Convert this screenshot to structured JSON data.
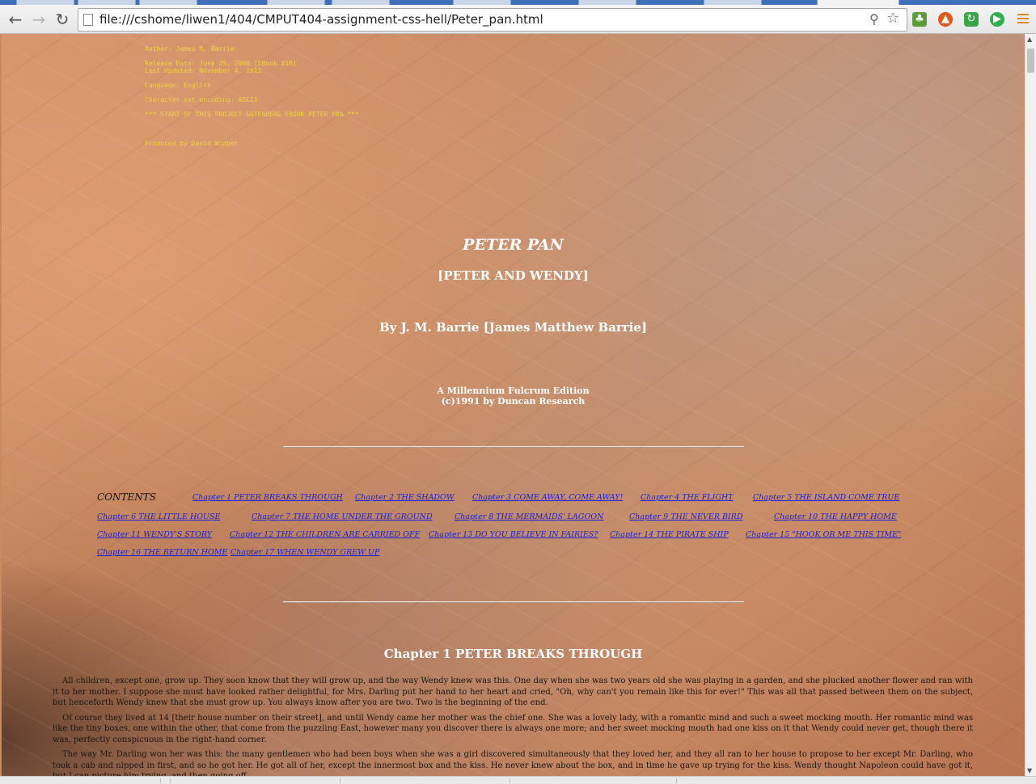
{
  "browser": {
    "url": "file:///cshome/liwen1/404/CMPUT404-assignment-css-hell/Peter_pan.html"
  },
  "gutenberg_header": [
    "Author: James M. Barrie",
    "Release Date: June 25, 2008 [EBook #16]\nLast Updated: November 4, 2012",
    "Language: English",
    "Character set encoding: ASCII",
    "*** START OF THIS PROJECT GUTENBERG EBOOK PETER PAN ***",
    "Produced by David Widger"
  ],
  "title": "PETER PAN",
  "subtitle": "[PETER AND WENDY]",
  "author_line": "By J. M. Barrie [James Matthew Barrie]",
  "edition": [
    "A Millennium Fulcrum Edition",
    "(c)1991 by Duncan Research"
  ],
  "contents_label": "CONTENTS",
  "toc": [
    "Chapter 1 PETER BREAKS THROUGH",
    "Chapter 2 THE SHADOW",
    "Chapter 3 COME AWAY, COME AWAY!",
    "Chapter 4 THE FLIGHT",
    "Chapter 5 THE ISLAND COME TRUE",
    "Chapter 6 THE LITTLE HOUSE",
    "Chapter 7 THE HOME UNDER THE GROUND",
    "Chapter 8 THE MERMAIDS' LAGOON",
    "Chapter 9 THE NEVER BIRD",
    "Chapter 10 THE HAPPY HOME",
    "Chapter 11 WENDY'S STORY",
    "Chapter 12 THE CHILDREN ARE CARRIED OFF",
    "Chapter 13 DO YOU BELIEVE IN FAIRIES?",
    "Chapter 14 THE PIRATE SHIP",
    "Chapter 15 \"HOOK OR ME THIS TIME\"",
    "Chapter 16 THE RETURN HOME",
    "Chapter 17 WHEN WENDY GREW UP"
  ],
  "chapter_heading": "Chapter 1 PETER BREAKS THROUGH",
  "paragraphs": [
    "All children, except one, grow up. They soon know that they will grow up, and the way Wendy knew was this. One day when she was two years old she was playing in a garden, and she plucked another flower and ran with it to her mother. I suppose she must have looked rather delightful, for Mrs. Darling put her hand to her heart and cried, \"Oh, why can't you remain like this for ever!\" This was all that passed between them on the subject, but henceforth Wendy knew that she must grow up. You always know after you are two. Two is the beginning of the end.",
    "Of course they lived at 14 [their house number on their street], and until Wendy came her mother was the chief one. She was a lovely lady, with a romantic mind and such a sweet mocking mouth. Her romantic mind was like the tiny boxes, one within the other, that come from the puzzling East, however many you discover there is always one more; and her sweet mocking mouth had one kiss on it that Wendy could never get, though there it was, perfectly conspicuous in the right-hand corner.",
    "The way Mr. Darling won her was this: the many gentlemen who had been boys when she was a girl discovered simultaneously that they loved her, and they all ran to her house to propose to her except Mr. Darling, who took a cab and nipped in first, and so he got her. He got all of her, except the innermost box and the kiss. He never knew about the box, and in time he gave up trying for the kiss. Wendy thought Napoleon could have got it, but I can picture him trying, and then going off"
  ]
}
